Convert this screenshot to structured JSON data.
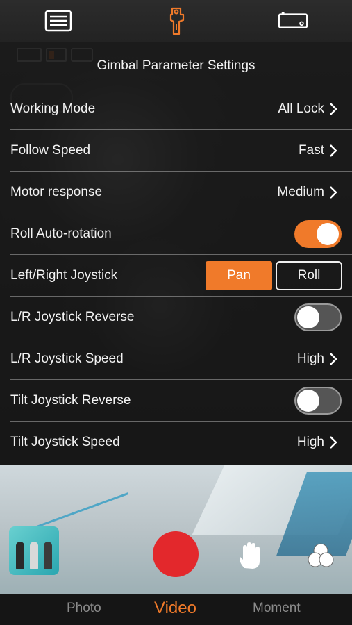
{
  "top_bar": {
    "icons": [
      "menu-list-icon",
      "gimbal-icon",
      "camera-settings-icon"
    ],
    "active_color": "#f07a2a"
  },
  "panel": {
    "title": "Gimbal Parameter Settings",
    "rows": [
      {
        "label": "Working Mode",
        "value": "All Lock",
        "type": "select"
      },
      {
        "label": "Follow Speed",
        "value": "Fast",
        "type": "select"
      },
      {
        "label": "Motor response",
        "value": "Medium",
        "type": "select"
      },
      {
        "label": "Roll Auto-rotation",
        "type": "toggle",
        "on": true
      },
      {
        "label": "Left/Right Joystick",
        "type": "segmented",
        "options": [
          "Pan",
          "Roll"
        ],
        "selected": "Pan"
      },
      {
        "label": "L/R Joystick Reverse",
        "type": "toggle",
        "on": false
      },
      {
        "label": "L/R Joystick Speed",
        "value": "High",
        "type": "select"
      },
      {
        "label": "Tilt Joystick Reverse",
        "type": "toggle",
        "on": false
      },
      {
        "label": "Tilt Joystick Speed",
        "value": "High",
        "type": "select"
      }
    ]
  },
  "capture_bar": {
    "record_color": "#e3282c",
    "icons": [
      "gallery-thumbnail",
      "record-button",
      "gesture-hand-icon",
      "filters-icon"
    ]
  },
  "modes": {
    "photo": "Photo",
    "video": "Video",
    "moment": "Moment",
    "selected": "Video"
  }
}
